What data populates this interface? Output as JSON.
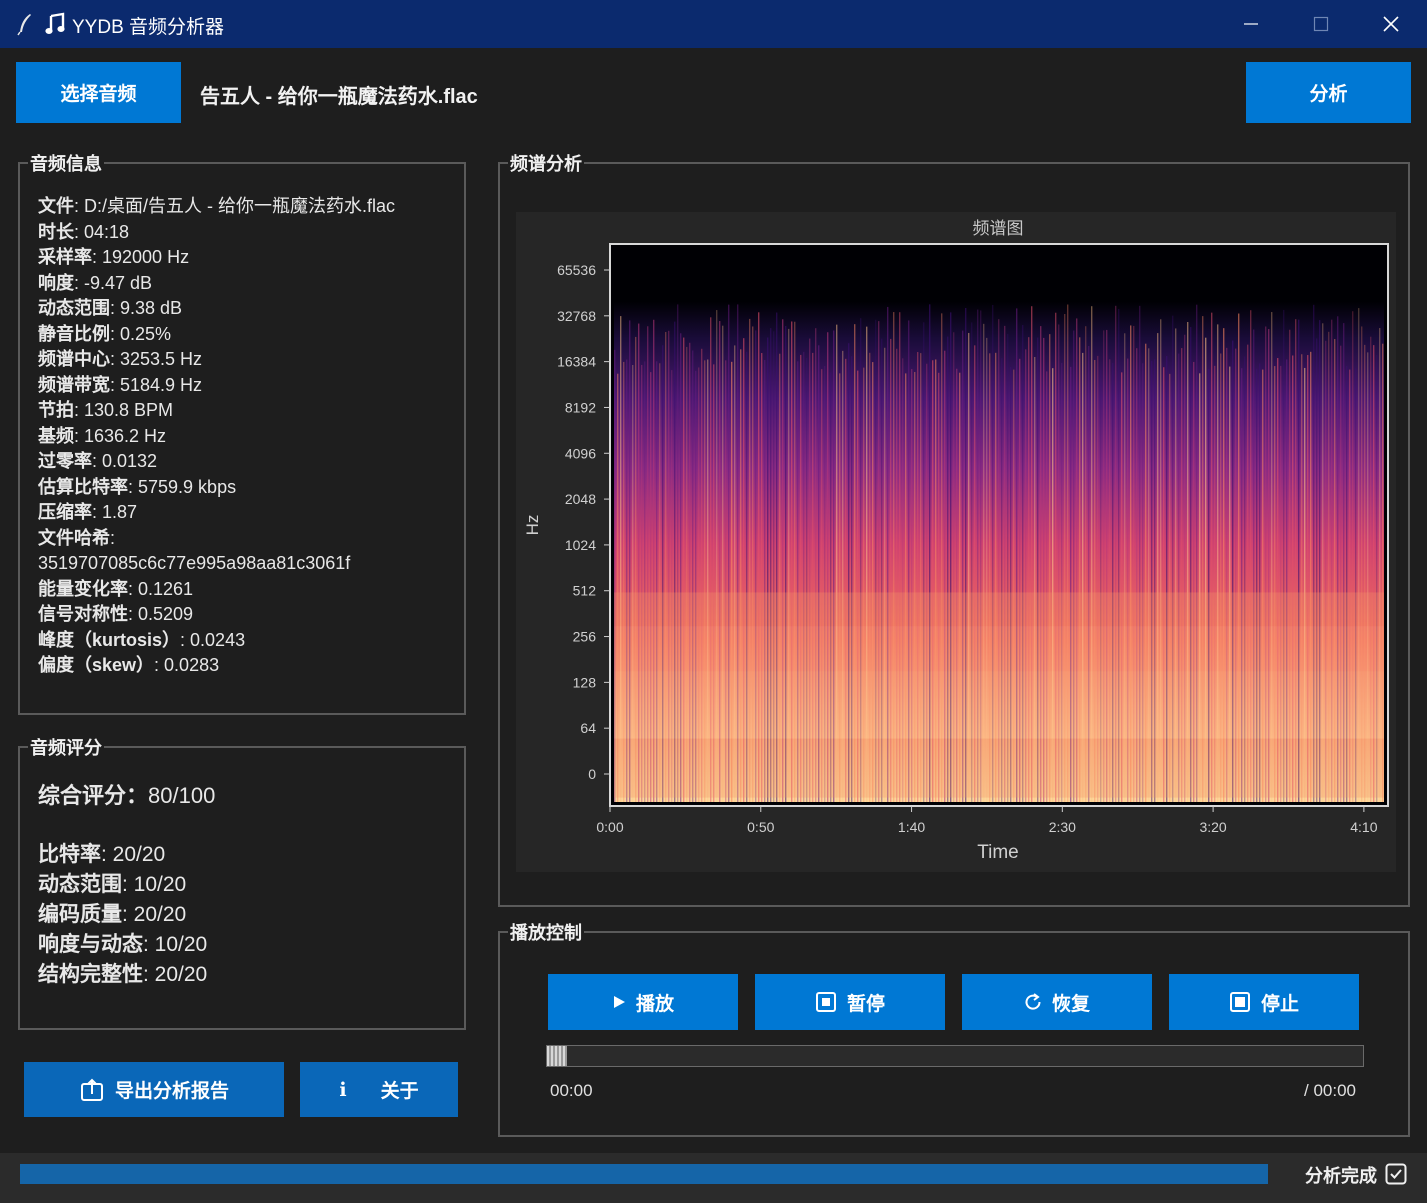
{
  "window": {
    "title": "YYDB 音频分析器"
  },
  "toolbar": {
    "select_label": "选择音频",
    "file_name": "告五人 - 给你一瓶魔法药水.flac",
    "analyze_label": "分析"
  },
  "info": {
    "title": "音频信息",
    "items": [
      {
        "k": "文件",
        "v": ": D:/桌面/告五人 - 给你一瓶魔法药水.flac"
      },
      {
        "k": "时长",
        "v": ": 04:18"
      },
      {
        "k": "采样率",
        "v": ": 192000 Hz"
      },
      {
        "k": "响度",
        "v": ": -9.47 dB"
      },
      {
        "k": "动态范围",
        "v": ": 9.38 dB"
      },
      {
        "k": "静音比例",
        "v": ": 0.25%"
      },
      {
        "k": "频谱中心",
        "v": ": 3253.5 Hz"
      },
      {
        "k": "频谱带宽",
        "v": ": 5184.9 Hz"
      },
      {
        "k": "节拍",
        "v": ": 130.8 BPM"
      },
      {
        "k": "基频",
        "v": ": 1636.2 Hz"
      },
      {
        "k": "过零率",
        "v": ": 0.0132"
      },
      {
        "k": "估算比特率",
        "v": ": 5759.9 kbps"
      },
      {
        "k": "压缩率",
        "v": ": 1.87"
      },
      {
        "k": "文件哈希",
        "v": ":"
      },
      {
        "k": "",
        "v": "3519707085c6c77e995a98aa81c3061f"
      },
      {
        "k": "能量变化率",
        "v": ": 0.1261"
      },
      {
        "k": "信号对称性",
        "v": ": 0.5209"
      },
      {
        "k": "峰度（kurtosis）",
        "v": ": 0.0243"
      },
      {
        "k": "偏度（skew）",
        "v": ": 0.0283"
      }
    ]
  },
  "score": {
    "title": "音频评分",
    "total_label": "综合评分：",
    "total_value": "80/100",
    "items": [
      {
        "k": "比特率",
        "v": ": 20/20"
      },
      {
        "k": "动态范围",
        "v": ": 10/20"
      },
      {
        "k": "编码质量",
        "v": ": 20/20"
      },
      {
        "k": "响度与动态",
        "v": ": 10/20"
      },
      {
        "k": "结构完整性",
        "v": ": 20/20"
      }
    ]
  },
  "actions": {
    "export_label": "导出分析报告",
    "about_icon": "i",
    "about_label": "关于"
  },
  "spectrum": {
    "group_title": "频谱分析",
    "colors": {
      "low": "#000004",
      "mid": "#b5367a",
      "high": "#fcfdbf"
    }
  },
  "chart_data": {
    "type": "heatmap",
    "title": "频谱图",
    "xlabel": "Time",
    "ylabel": "Hz",
    "x_ticks": [
      "0:00",
      "0:50",
      "1:40",
      "2:30",
      "3:20",
      "4:10"
    ],
    "x_tick_seconds": [
      0,
      50,
      100,
      150,
      200,
      250
    ],
    "x_max_seconds": 258,
    "y_scale": "log2",
    "y_ticks": [
      "0",
      "64",
      "128",
      "256",
      "512",
      "1024",
      "2048",
      "4096",
      "8192",
      "16384",
      "32768",
      "65536"
    ],
    "colormap": "magma"
  },
  "playback": {
    "title": "播放控制",
    "play": "播放",
    "pause": "暂停",
    "resume": "恢复",
    "stop": "停止",
    "current_time": "00:00",
    "total_time": "/ 00:00",
    "position": 0
  },
  "status": {
    "text": "分析完成",
    "progress": 1.0
  }
}
